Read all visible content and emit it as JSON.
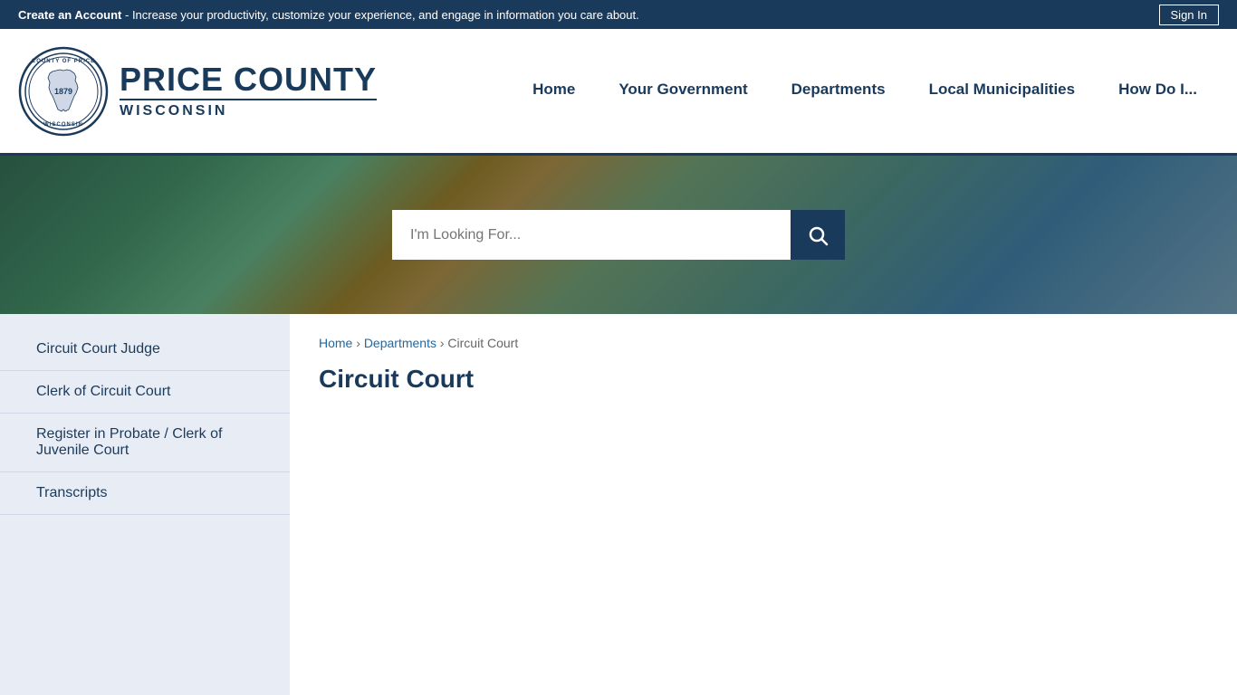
{
  "topBanner": {
    "createAccountText": "Create an Account",
    "bannerMessage": " - Increase your productivity, customize your experience, and engage in information you care about.",
    "signInLabel": "Sign In"
  },
  "header": {
    "countyNameMain": "PRICE COUNTY",
    "countyNameSub": "WISCONSIN",
    "sealAlt": "County of Price Wisconsin seal established 1879"
  },
  "nav": {
    "items": [
      {
        "label": "Home",
        "id": "home"
      },
      {
        "label": "Your Government",
        "id": "your-government"
      },
      {
        "label": "Departments",
        "id": "departments"
      },
      {
        "label": "Local Municipalities",
        "id": "local-municipalities"
      },
      {
        "label": "How Do I...",
        "id": "how-do-i"
      }
    ]
  },
  "search": {
    "placeholder": "I'm Looking For...",
    "buttonLabel": "Search"
  },
  "sidebar": {
    "items": [
      {
        "label": "Circuit Court Judge",
        "id": "circuit-court-judge"
      },
      {
        "label": "Clerk of Circuit Court",
        "id": "clerk-of-circuit-court"
      },
      {
        "label": "Register in Probate / Clerk of Juvenile Court",
        "id": "register-in-probate"
      },
      {
        "label": "Transcripts",
        "id": "transcripts"
      }
    ]
  },
  "breadcrumb": {
    "home": "Home",
    "departments": "Departments",
    "current": "Circuit Court"
  },
  "page": {
    "title": "Circuit Court"
  }
}
